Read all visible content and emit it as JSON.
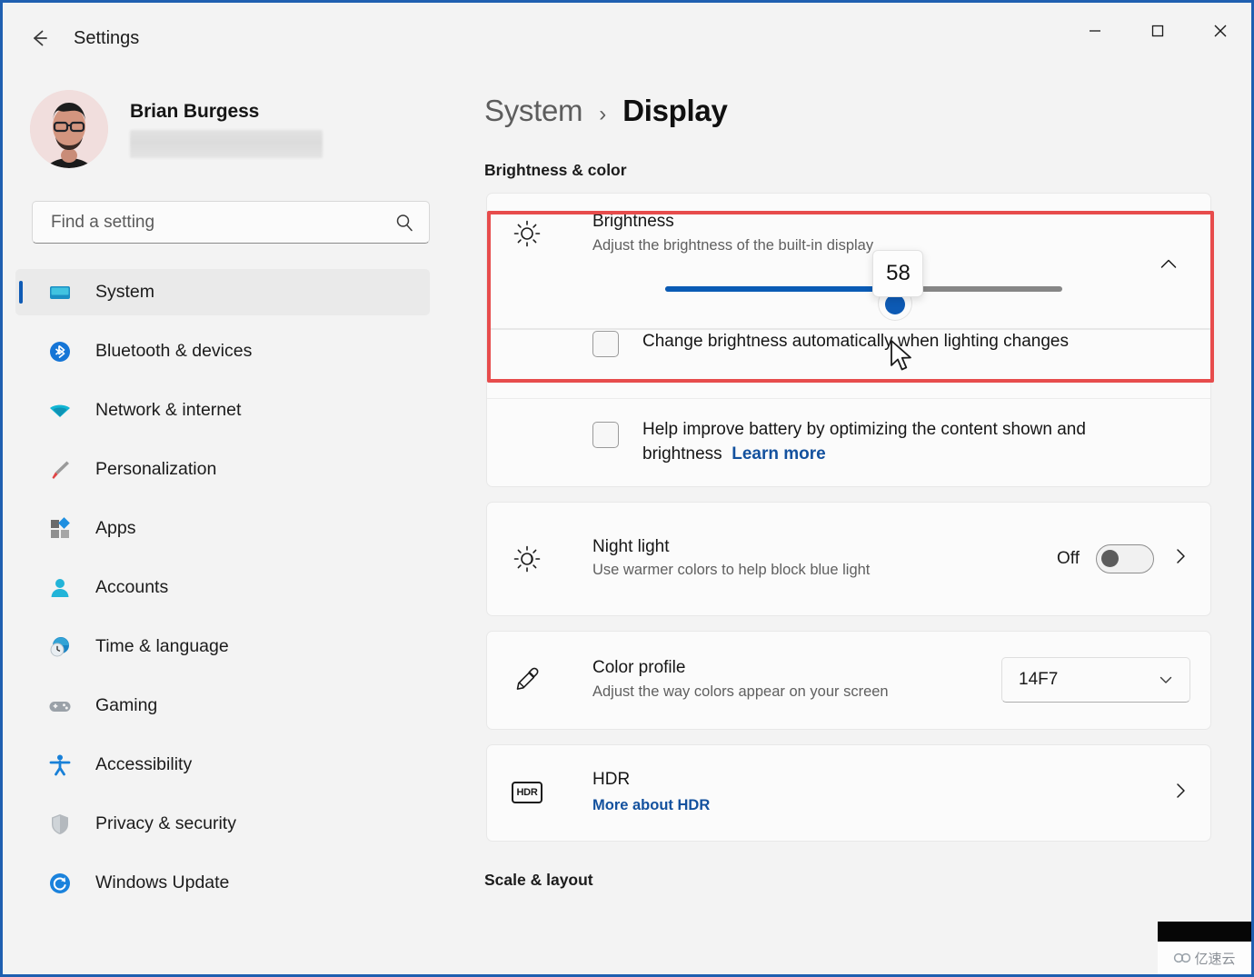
{
  "window": {
    "title": "Settings",
    "back_icon": "back-arrow-icon",
    "minimize": "–",
    "maximize": "□",
    "close": "✕",
    "accent": "#0f5bb5",
    "border_color": "#1f5fb0"
  },
  "account": {
    "name": "Brian Burgess",
    "email_redacted": ""
  },
  "search": {
    "placeholder": "Find a setting",
    "value": "",
    "icon": "search-icon"
  },
  "sidebar": {
    "items": [
      {
        "label": "System",
        "icon": "monitor-icon",
        "selected": true
      },
      {
        "label": "Bluetooth & devices",
        "icon": "bluetooth-icon",
        "selected": false
      },
      {
        "label": "Network & internet",
        "icon": "wifi-icon",
        "selected": false
      },
      {
        "label": "Personalization",
        "icon": "paintbrush-icon",
        "selected": false
      },
      {
        "label": "Apps",
        "icon": "apps-icon",
        "selected": false
      },
      {
        "label": "Accounts",
        "icon": "person-icon",
        "selected": false
      },
      {
        "label": "Time & language",
        "icon": "clock-globe-icon",
        "selected": false
      },
      {
        "label": "Gaming",
        "icon": "gamepad-icon",
        "selected": false
      },
      {
        "label": "Accessibility",
        "icon": "accessibility-icon",
        "selected": false
      },
      {
        "label": "Privacy & security",
        "icon": "shield-icon",
        "selected": false
      },
      {
        "label": "Windows Update",
        "icon": "update-refresh-icon",
        "selected": false
      }
    ]
  },
  "breadcrumb": {
    "parent": "System",
    "separator": "›",
    "current": "Display"
  },
  "main": {
    "section_heading": "Brightness & color",
    "bottom_heading": "Scale & layout",
    "brightness": {
      "title": "Brightness",
      "subtitle": "Adjust the brightness of the built-in display",
      "icon": "sun-icon",
      "expand_icon": "chevron-up-icon",
      "value": 58,
      "tooltip_value": "58",
      "min": 0,
      "max": 100,
      "fill_color": "#0a5bb5",
      "track_color": "#868686"
    },
    "auto_brightness": {
      "label": "Change brightness automatically when lighting changes",
      "checked": false
    },
    "content_adaptive": {
      "label": "Help improve battery by optimizing the content shown and brightness",
      "link_label": "Learn more",
      "checked": false
    },
    "night_light": {
      "title": "Night light",
      "subtitle": "Use warmer colors to help block blue light",
      "icon": "night-light-icon",
      "state_label": "Off",
      "enabled": false,
      "chevron": "chevron-right-icon"
    },
    "color_profile": {
      "title": "Color profile",
      "subtitle": "Adjust the way colors appear on your screen",
      "icon": "eyedropper-icon",
      "selected_option": "14F7",
      "chevron": "chevron-down-icon"
    },
    "hdr": {
      "title": "HDR",
      "link_label": "More about HDR",
      "icon": "hdr-badge-icon",
      "badge_text": "HDR",
      "chevron": "chevron-right-icon"
    }
  },
  "annotation": {
    "highlight_color": "#e74c4c",
    "target": "brightness-row"
  },
  "watermark": {
    "text": "亿速云",
    "icon": "cloud-logo-icon"
  }
}
